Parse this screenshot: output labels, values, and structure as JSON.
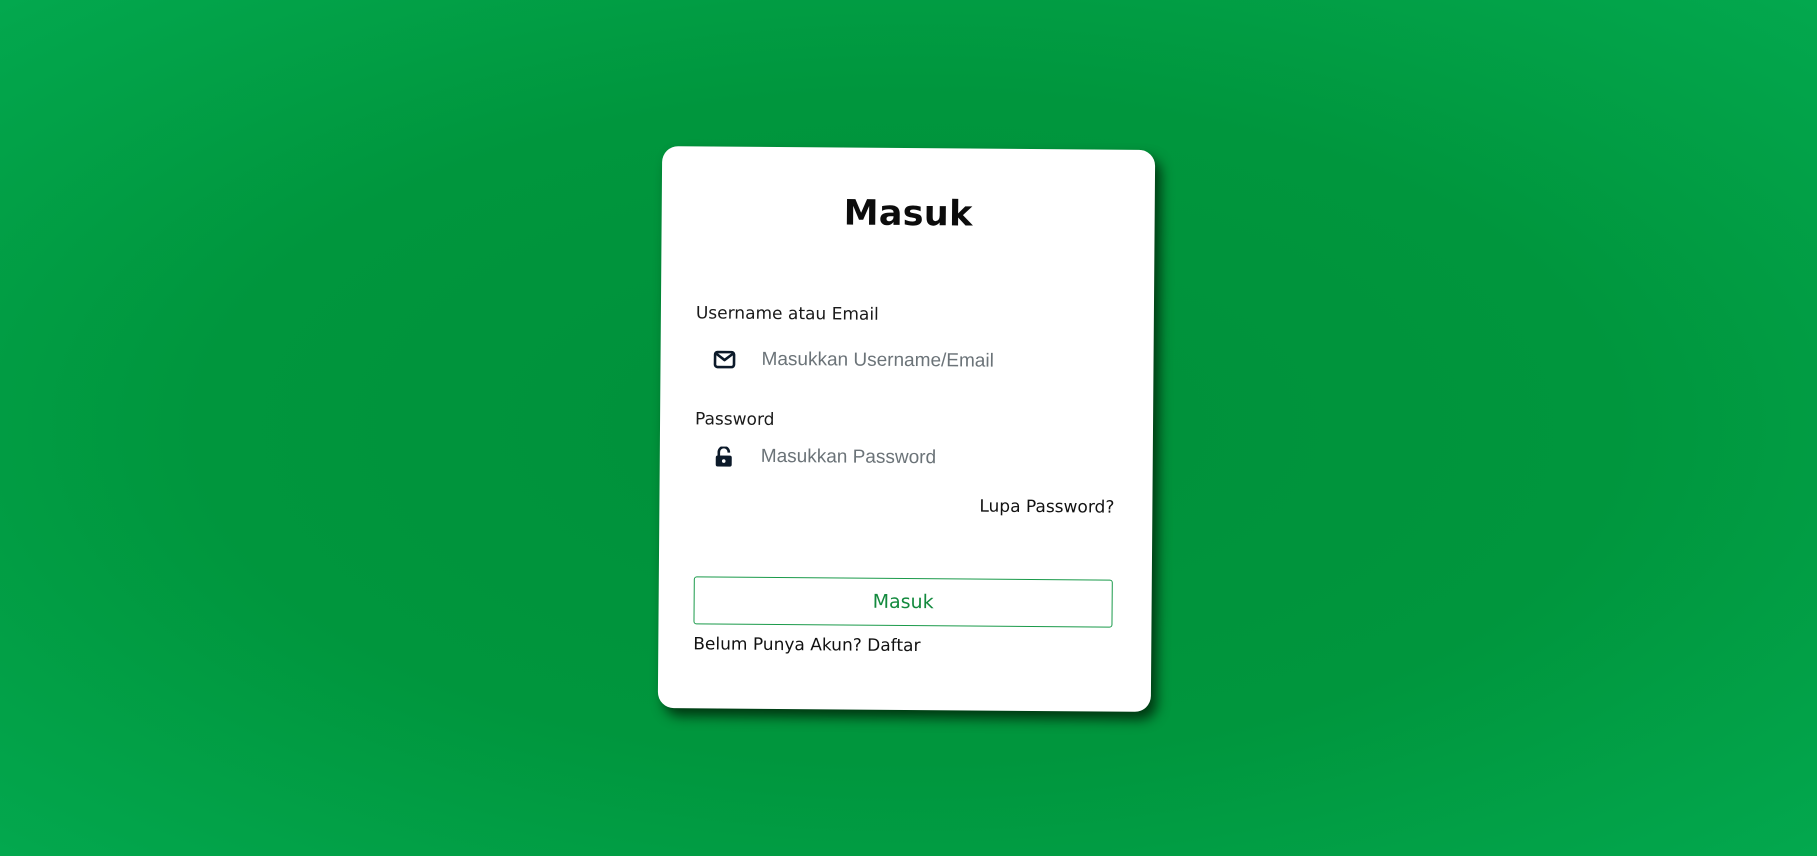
{
  "colors": {
    "background": "#00963d",
    "card": "#ffffff",
    "accent": "#138a3e"
  },
  "login": {
    "title": "Masuk",
    "username": {
      "label": "Username atau Email",
      "placeholder": "Masukkan Username/Email",
      "value": "",
      "icon": "envelope-icon"
    },
    "password": {
      "label": "Password",
      "placeholder": "Masukkan Password",
      "value": "",
      "icon": "unlock-icon"
    },
    "forgot_label": "Lupa Password?",
    "submit_label": "Masuk",
    "register_prompt": "Belum Punya Akun?",
    "register_link": "Daftar"
  }
}
